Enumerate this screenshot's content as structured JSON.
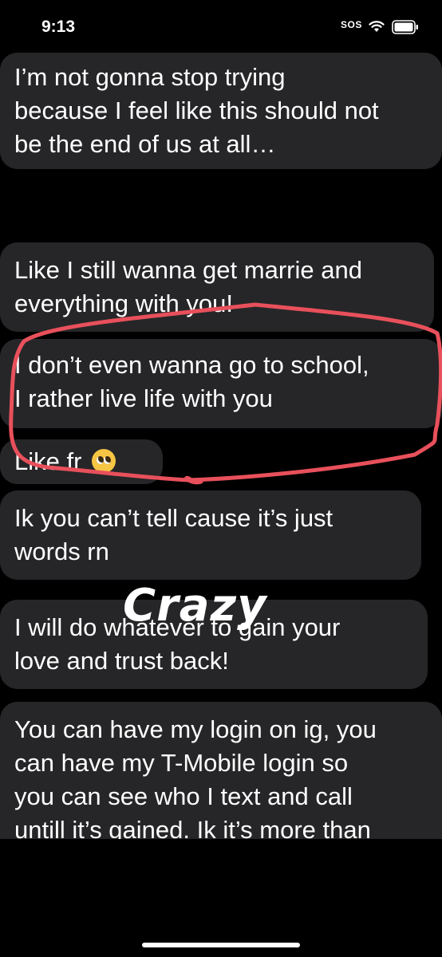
{
  "status_bar": {
    "time": "9:13",
    "carrier_text": "SOS",
    "wifi_icon": "wifi-icon",
    "battery_icon": "battery-icon"
  },
  "messages": [
    {
      "lines": [
        "I’m not gonna stop trying",
        "because I feel like this should not",
        "be the end of us at all…"
      ]
    },
    {
      "lines": [
        "Like I still wanna get marrie and",
        "everything with you!"
      ]
    },
    {
      "lines": [
        "I don’t even wanna go to school,",
        "I rather live life with you"
      ]
    },
    {
      "lines": [
        "Like fr"
      ],
      "emoji": "pleading-face-icon"
    },
    {
      "lines": [
        "Ik you can’t tell cause it’s just",
        "words rn"
      ]
    },
    {
      "lines": [
        "I will do whatever to gain your",
        "love and trust back!"
      ]
    },
    {
      "lines": [
        "You can have my login on ig, you",
        "can have my T-Mobile login so",
        "you can see who I text and call",
        "untill it’s gained. Ik it’s more than"
      ]
    }
  ],
  "overlay": {
    "caption": "Crazy",
    "highlight_color": "#e8505b"
  },
  "colors": {
    "background": "#000000",
    "bubble": "#262628",
    "text": "#ffffff"
  }
}
